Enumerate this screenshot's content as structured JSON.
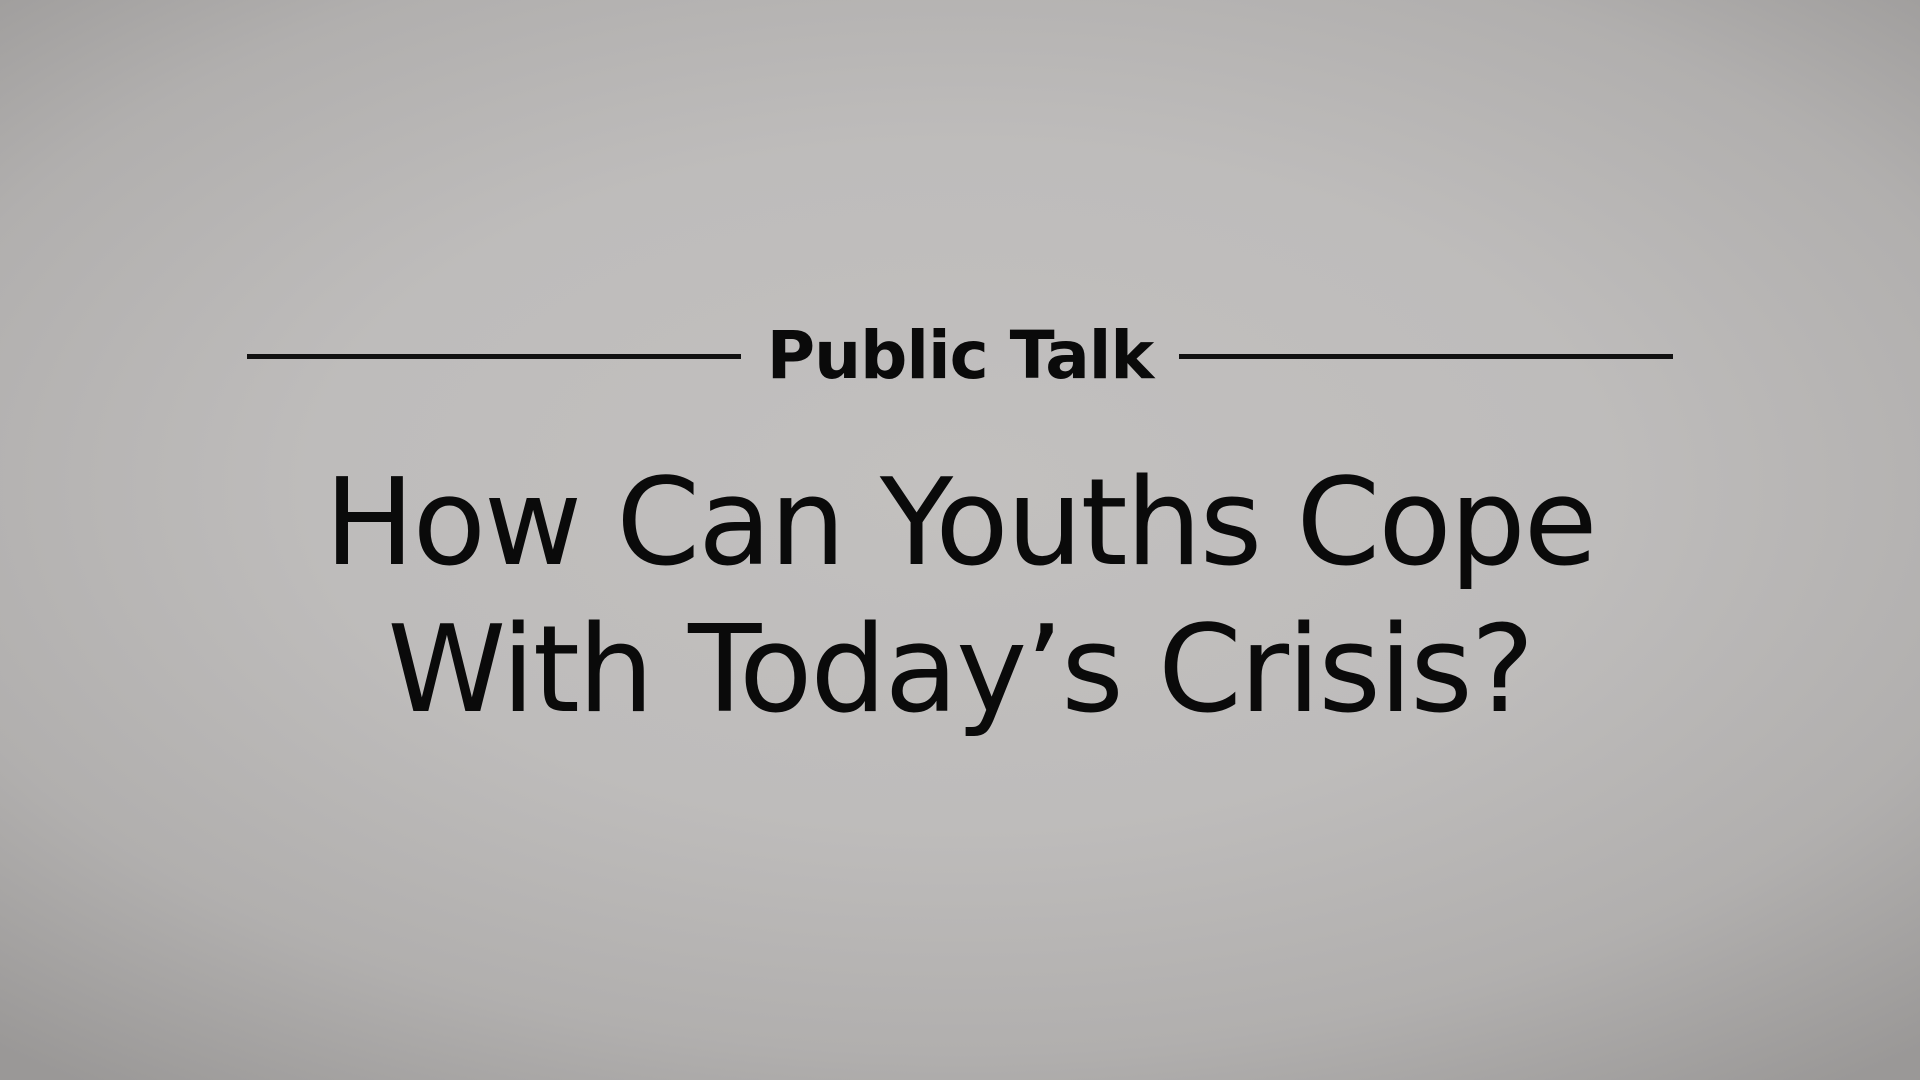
{
  "slide": {
    "kicker": "Public Talk",
    "title_lines": [
      "How Can Youths Cope",
      "With Today’s Crisis?"
    ]
  },
  "colors": {
    "background": "#bdbbba",
    "text": "#0a0a0a",
    "rule": "#111111"
  }
}
